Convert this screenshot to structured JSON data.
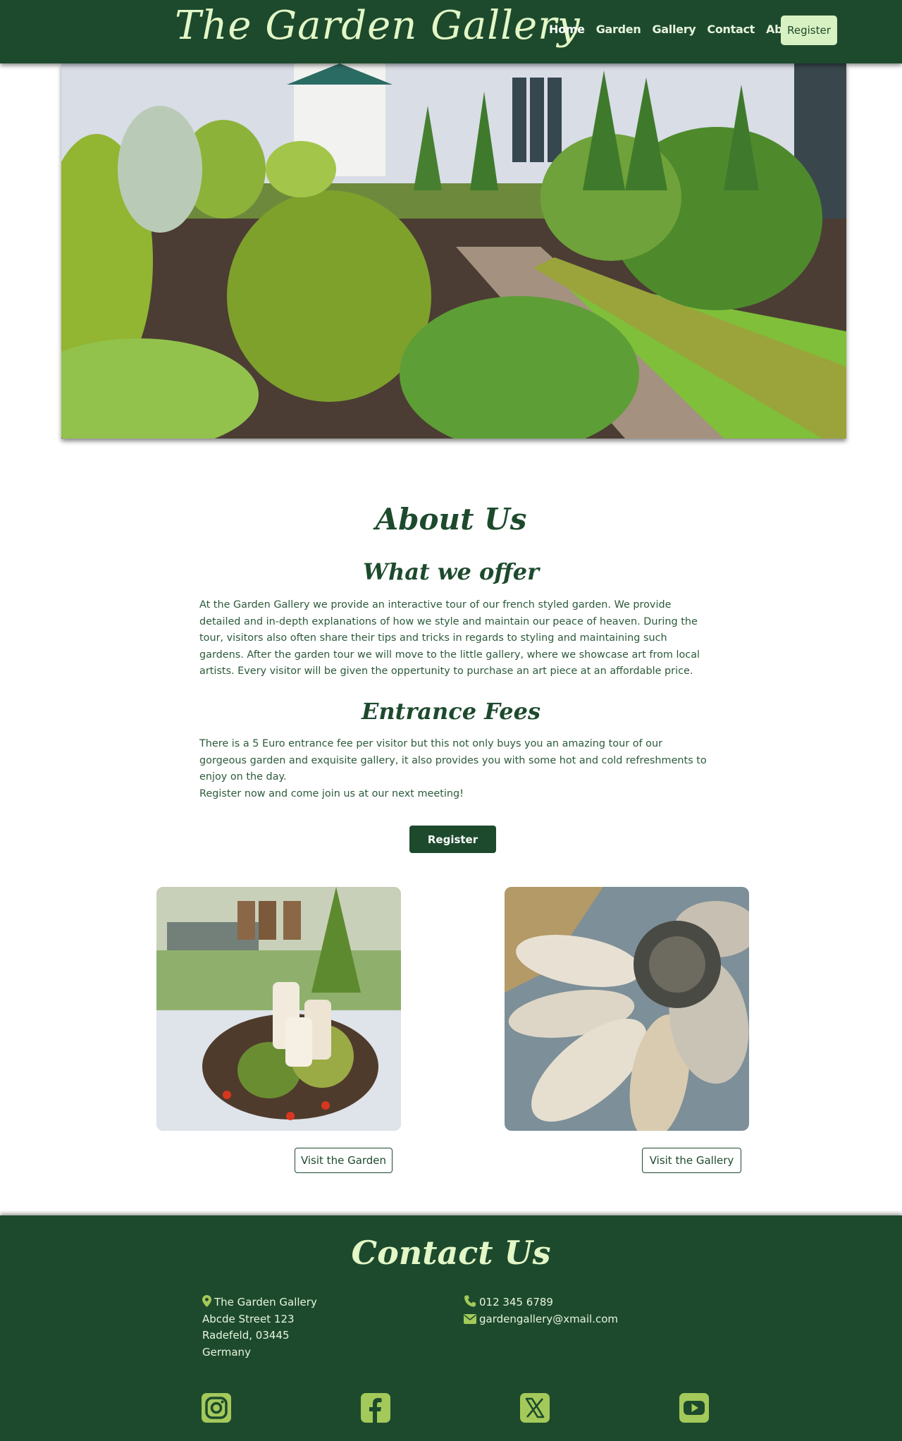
{
  "navbar": {
    "brand": "The Garden Gallery",
    "links": [
      "Home",
      "Garden",
      "Gallery",
      "Contact",
      "About"
    ],
    "register_label": "Register"
  },
  "about": {
    "title": "About Us",
    "offer_title": "What we offer",
    "offer_text": "At the Garden Gallery we provide an interactive tour of our french styled garden. We provide detailed and in-depth explanations of how we style and maintain our peace of heaven. During the tour, visitors also often share their tips and tricks in regards to styling and maintaining such gardens. After the garden tour we will move to the little gallery, where we showcase art from local artists. Every visitor will be given the oppertunity to purchase an art piece at an affordable price.",
    "fees_title": "Entrance Fees",
    "fees_text": "There is a 5 Euro entrance fee per visitor but this not only buys you an amazing tour of our gorgeous garden and exquisite gallery, it also provides you with some hot and cold refreshments to enjoy on the day.",
    "fees_cta": "Register now and come join us at our next meeting!",
    "register_label": "Register"
  },
  "cards": {
    "garden_button": "Visit the Garden",
    "gallery_button": "Visit the Gallery"
  },
  "footer": {
    "title": "Contact Us",
    "address": [
      "The Garden Gallery",
      "Abcde Street 123",
      "Radefeld, 03445",
      "Germany"
    ],
    "phone": "012 345 6789",
    "email": "gardengallery@xmail.com",
    "social": [
      "instagram-icon",
      "facebook-icon",
      "x-icon",
      "youtube-icon"
    ]
  },
  "colors": {
    "primary": "#1d4a2d",
    "accent": "#d8f1c2",
    "icon": "#a3c95a"
  }
}
